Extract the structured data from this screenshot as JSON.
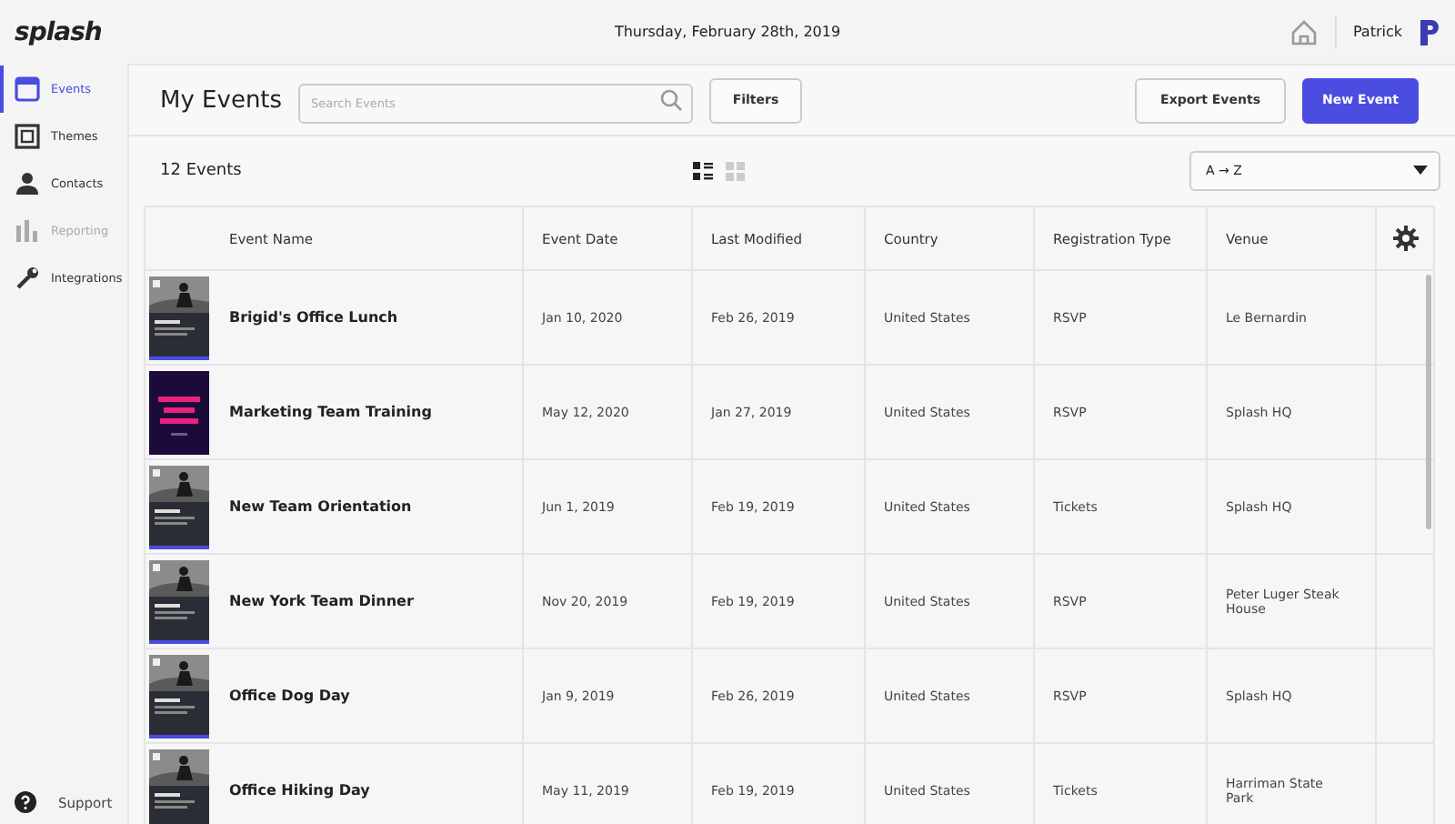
{
  "topbar": {
    "logo": "splash",
    "date": "Thursday, February 28th, 2019",
    "user": "Patrick"
  },
  "sidebar": {
    "items": [
      {
        "label": "Events",
        "selected": true,
        "disabled": false
      },
      {
        "label": "Themes",
        "selected": false,
        "disabled": false
      },
      {
        "label": "Contacts",
        "selected": false,
        "disabled": false
      },
      {
        "label": "Reporting",
        "selected": false,
        "disabled": true
      },
      {
        "label": "Integrations",
        "selected": false,
        "disabled": false
      }
    ],
    "support": "Support"
  },
  "header": {
    "title": "My Events",
    "search": {
      "placeholder": "Search Events"
    },
    "filters": "Filters",
    "export": "Export Events",
    "new_event": "New Event"
  },
  "toolbar": {
    "count": "12 Events",
    "views": [
      {
        "kind": "list",
        "selected": true
      },
      {
        "kind": "grid",
        "selected": false
      }
    ],
    "sort": "A → Z"
  },
  "table": {
    "columns": [
      "Event Name",
      "Event Date",
      "Last Modified",
      "Country",
      "Registration Type",
      "Venue"
    ],
    "rows": [
      {
        "name": "Brigid's Office Lunch",
        "date": "Jan 10, 2020",
        "modified": "Feb 26, 2019",
        "country": "United States",
        "registration": "RSVP",
        "venue": "Le Bernardin"
      },
      {
        "name": "Marketing Team Training",
        "date": "May 12, 2020",
        "modified": "Jan 27, 2019",
        "country": "United States",
        "registration": "RSVP",
        "venue": "Splash HQ"
      },
      {
        "name": "New Team Orientation",
        "date": "Jun 1, 2019",
        "modified": "Feb 19, 2019",
        "country": "United States",
        "registration": "Tickets",
        "venue": "Splash HQ"
      },
      {
        "name": "New York Team Dinner",
        "date": "Nov 20, 2019",
        "modified": "Feb 19, 2019",
        "country": "United States",
        "registration": "RSVP",
        "venue": "Peter Luger Steak House"
      },
      {
        "name": "Office Dog Day",
        "date": "Jan 9, 2019",
        "modified": "Feb 26, 2019",
        "country": "United States",
        "registration": "RSVP",
        "venue": "Splash HQ"
      },
      {
        "name": "Office Hiking Day",
        "date": "May 11, 2019",
        "modified": "Feb 19, 2019",
        "country": "United States",
        "registration": "Tickets",
        "venue": "Harriman State Park"
      }
    ]
  }
}
